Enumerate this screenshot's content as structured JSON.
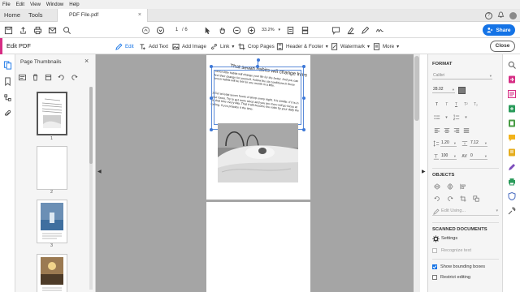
{
  "menu": [
    "File",
    "Edit",
    "View",
    "Window",
    "Help"
  ],
  "tabs": {
    "home": "Home",
    "tools": "Tools",
    "file": "PDF File.pdf",
    "close_glyph": "×"
  },
  "toolbar": {
    "page_current": "1",
    "page_total": "/ 6",
    "zoom": "33.2%",
    "share_label": "Share"
  },
  "edit_bar": {
    "title": "Edit PDF",
    "tools": {
      "edit": "Edit",
      "add_text": "Add Text",
      "add_image": "Add Image",
      "link": "Link",
      "crop": "Crop Pages",
      "header_footer": "Header & Footer",
      "watermark": "Watermark",
      "more": "More"
    },
    "close_label": "Close"
  },
  "thumbnails": {
    "title": "Page Thumbnails",
    "pages": [
      {
        "number": "1",
        "selected": true
      },
      {
        "number": "2",
        "selected": false
      },
      {
        "number": "3",
        "selected": false
      }
    ]
  },
  "document": {
    "title": "That seven habits will change lives",
    "para1": "Seven little habits will change your life for the better. And you can feel their change for yourself. Follow the six conditions in these seven habits will be felt for one month in a little.",
    "para2": "1.Get at least seven hours of sleep every night. It is similar. If it is in your focus. Try to get more sleep and you are more will go focus at on that time every day. That it will become the relax by your daily the feeling. If you practice it the time.",
    "photo_desc": "photo"
  },
  "format_panel": {
    "format_title": "FORMAT",
    "font_name": "Calibri",
    "font_size": "28.02",
    "line_spacing": "1.20",
    "para_spacing": "7.12",
    "horiz_scale": "100",
    "char_spacing": "0",
    "objects_title": "OBJECTS",
    "edit_using": "Edit Using...",
    "scanned_title": "SCANNED DOCUMENTS",
    "settings": "Settings",
    "recognize": "Recognize text",
    "show_bbox": "Show bounding boxes",
    "restrict": "Restrict editing",
    "show_bbox_checked": true,
    "restrict_checked": false
  },
  "colors": {
    "accent_pink": "#d62d84",
    "share_blue": "#1473e6",
    "selection_blue": "#3d78d8"
  }
}
